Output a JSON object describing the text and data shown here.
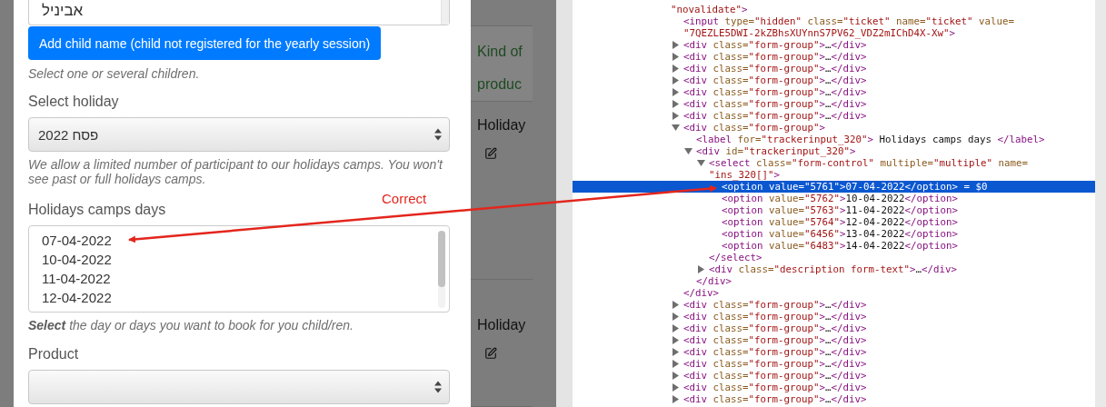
{
  "children_list": {
    "visible_name": "אביניל"
  },
  "add_child_button": "Add child name (child not registered for the yearly session)",
  "children_help": "Select one or several children.",
  "holiday": {
    "label": "Select holiday",
    "value": "פסח 2022",
    "help": "We allow a limited number of participant to our holidays camps. You won't see past or full holidays camps."
  },
  "camp_days": {
    "label": "Holidays camps days",
    "options": [
      {
        "label": "07-04-2022",
        "selected": false
      },
      {
        "label": "10-04-2022",
        "selected": false
      },
      {
        "label": "11-04-2022",
        "selected": false
      },
      {
        "label": "12-04-2022",
        "selected": false
      }
    ],
    "help": "**Select** the day or days you want to book for you child/ren."
  },
  "product": {
    "label": "Product"
  },
  "background_table": {
    "header": "Kind of produc",
    "rows": [
      {
        "label": "Holiday"
      },
      {
        "label": "Holiday"
      }
    ]
  },
  "annotation": {
    "label": "Correct"
  },
  "devtools": {
    "tree": [
      {
        "lines": [
          "\"novalidate\">"
        ],
        "selected": false,
        "children": [
          {
            "lines": [
              "<input type=\"hidden\" class=\"ticket\" name=\"ticket\" value=",
              "\"7QEZLE5DWI-2kZBhsXUYnnS7PV62_VDZ2mIChD4X-Xw\">"
            ],
            "selected": false
          },
          {
            "lines": [
              "<div class=\"form-group\">…</div>"
            ],
            "kind": "collapsed",
            "selected": false
          },
          {
            "lines": [
              "<div class=\"form-group\">…</div>"
            ],
            "kind": "collapsed",
            "selected": false
          },
          {
            "lines": [
              "<div class=\"form-group\">…</div>"
            ],
            "kind": "collapsed",
            "selected": false
          },
          {
            "lines": [
              "<div class=\"form-group\">…</div>"
            ],
            "kind": "collapsed",
            "selected": false
          },
          {
            "lines": [
              "<div class=\"form-group\">…</div>"
            ],
            "kind": "collapsed",
            "selected": false
          },
          {
            "lines": [
              "<div class=\"form-group\">…</div>"
            ],
            "kind": "collapsed",
            "selected": false
          },
          {
            "lines": [
              "<div class=\"form-group\">…</div>"
            ],
            "kind": "collapsed",
            "selected": false
          },
          {
            "lines": [
              "<div class=\"form-group\">"
            ],
            "kind": "expanded",
            "selected": false,
            "closing": "</div>",
            "children": [
              {
                "lines": [
                  "<label for=\"trackerinput_320\"> Holidays camps days </label>"
                ],
                "selected": false
              },
              {
                "lines": [
                  "<div id=\"trackerinput_320\">"
                ],
                "kind": "expanded",
                "selected": false,
                "closing": "</div>",
                "children": [
                  {
                    "lines": [
                      "<select class=\"form-control\" multiple=\"multiple\" name=",
                      "\"ins_320[]\">"
                    ],
                    "kind": "expanded",
                    "selected": false,
                    "closing": "</select>",
                    "children": [
                      {
                        "lines": [
                          "<option value=\"5761\">07-04-2022</option> = $0"
                        ],
                        "selected": true
                      },
                      {
                        "lines": [
                          "<option value=\"5762\">10-04-2022</option>"
                        ],
                        "selected": false
                      },
                      {
                        "lines": [
                          "<option value=\"5763\">11-04-2022</option>"
                        ],
                        "selected": false
                      },
                      {
                        "lines": [
                          "<option value=\"5764\">12-04-2022</option>"
                        ],
                        "selected": false
                      },
                      {
                        "lines": [
                          "<option value=\"6456\">13-04-2022</option>"
                        ],
                        "selected": false
                      },
                      {
                        "lines": [
                          "<option value=\"6483\">14-04-2022</option>"
                        ],
                        "selected": false
                      }
                    ]
                  },
                  {
                    "lines": [
                      "<div class=\"description form-text\">…</div>"
                    ],
                    "kind": "collapsed",
                    "selected": false
                  }
                ]
              }
            ]
          },
          {
            "lines": [
              "<div class=\"form-group\">…</div>"
            ],
            "kind": "collapsed",
            "selected": false
          },
          {
            "lines": [
              "<div class=\"form-group\">…</div>"
            ],
            "kind": "collapsed",
            "selected": false
          },
          {
            "lines": [
              "<div class=\"form-group\">…</div>"
            ],
            "kind": "collapsed",
            "selected": false
          },
          {
            "lines": [
              "<div class=\"form-group\">…</div>"
            ],
            "kind": "collapsed",
            "selected": false
          },
          {
            "lines": [
              "<div class=\"form-group\">…</div>"
            ],
            "kind": "collapsed",
            "selected": false
          },
          {
            "lines": [
              "<div class=\"form-group\">…</div>"
            ],
            "kind": "collapsed",
            "selected": false
          },
          {
            "lines": [
              "<div class=\"form-group\">…</div>"
            ],
            "kind": "collapsed",
            "selected": false
          },
          {
            "lines": [
              "<div class=\"form-group\">…</div>"
            ],
            "kind": "collapsed",
            "selected": false
          },
          {
            "lines": [
              "<div class=\"form-group\">…</div>"
            ],
            "kind": "collapsed",
            "selected": false
          }
        ]
      }
    ]
  }
}
